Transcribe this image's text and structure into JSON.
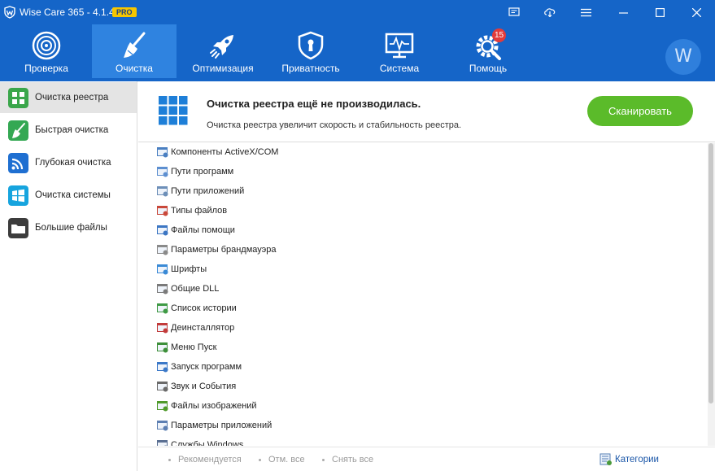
{
  "app": {
    "title": "Wise Care 365 - 4.1.4",
    "badge": "PRO",
    "brand_color": "#1565c8",
    "accent_color": "#5bbb2a"
  },
  "titlebar": {
    "buttons": [
      {
        "icon": "feedback-icon"
      },
      {
        "icon": "cloud-icon"
      },
      {
        "icon": "menu-icon"
      },
      {
        "icon": "minimize-icon"
      },
      {
        "icon": "maximize-icon"
      },
      {
        "icon": "close-icon"
      }
    ]
  },
  "nav": {
    "tabs": [
      {
        "label": "Проверка",
        "icon": "radar-icon"
      },
      {
        "label": "Очистка",
        "icon": "broom-icon",
        "active": true
      },
      {
        "label": "Оптимизация",
        "icon": "rocket-icon"
      },
      {
        "label": "Приватность",
        "icon": "shield-icon"
      },
      {
        "label": "Система",
        "icon": "monitor-icon"
      },
      {
        "label": "Помощь",
        "icon": "gear-wrench-icon",
        "badge": "15"
      }
    ],
    "avatar_letter": "W"
  },
  "sidebar": {
    "items": [
      {
        "label": "Очистка реестра",
        "icon": "registry-icon",
        "color": "#3aa64a",
        "active": true
      },
      {
        "label": "Быстрая очистка",
        "icon": "broom-icon",
        "color": "#34a853"
      },
      {
        "label": "Глубокая очистка",
        "icon": "disk-icon",
        "color": "#1f6fd1"
      },
      {
        "label": "Очистка системы",
        "icon": "windows-icon",
        "color": "#16a4de"
      },
      {
        "label": "Большие файлы",
        "icon": "folder-icon",
        "color": "#3c3c3c"
      }
    ]
  },
  "header": {
    "title": "Очистка реестра ещё не производилась.",
    "subtitle": "Очистка реестра увеличит скорость и стабильность реестра.",
    "scan_label": "Сканировать"
  },
  "registry_items": [
    {
      "label": "Компоненты ActiveX/COM",
      "icon": "activex-icon"
    },
    {
      "label": "Пути программ",
      "icon": "program-path-icon"
    },
    {
      "label": "Пути приложений",
      "icon": "app-path-icon"
    },
    {
      "label": "Типы файлов",
      "icon": "file-type-icon"
    },
    {
      "label": "Файлы помощи",
      "icon": "help-file-icon"
    },
    {
      "label": "Параметры брандмауэра",
      "icon": "firewall-icon"
    },
    {
      "label": "Шрифты",
      "icon": "font-icon"
    },
    {
      "label": "Общие DLL",
      "icon": "dll-icon"
    },
    {
      "label": "Список истории",
      "icon": "history-icon"
    },
    {
      "label": "Деинсталлятор",
      "icon": "uninstaller-icon"
    },
    {
      "label": "Меню Пуск",
      "icon": "start-menu-icon"
    },
    {
      "label": "Запуск программ",
      "icon": "startup-icon"
    },
    {
      "label": "Звук и События",
      "icon": "sound-icon"
    },
    {
      "label": "Файлы изображений",
      "icon": "image-file-icon"
    },
    {
      "label": "Параметры приложений",
      "icon": "app-settings-icon"
    },
    {
      "label": "Службы Windows",
      "icon": "services-icon"
    }
  ],
  "footer": {
    "recommended": "Рекомендуется",
    "select_all": "Отм. все",
    "deselect_all": "Снять все",
    "categories": "Категории"
  }
}
